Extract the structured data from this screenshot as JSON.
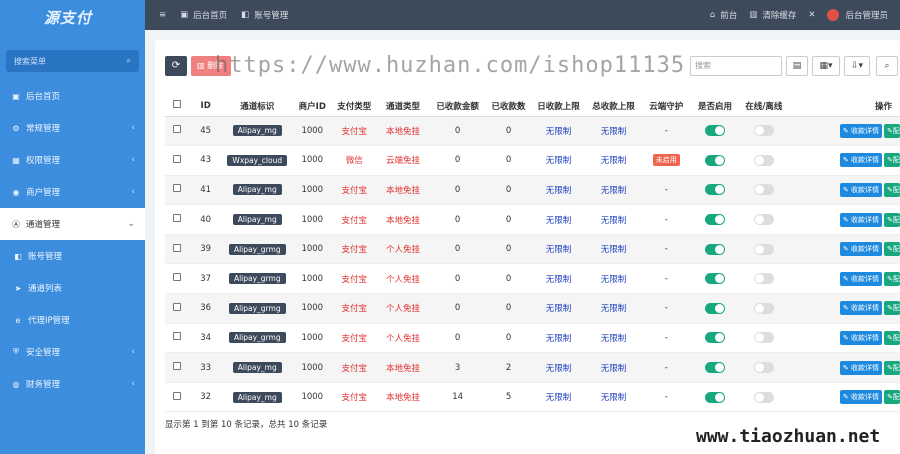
{
  "sidebar": {
    "logo_text": "源支付",
    "search_placeholder": "搜索菜单",
    "items": [
      {
        "label": "后台首页",
        "icon": "dashboard-icon",
        "glyph": "▣"
      },
      {
        "label": "常规管理",
        "icon": "gear-icon",
        "glyph": "⚙",
        "arrow": "‹"
      },
      {
        "label": "权限管理",
        "icon": "group-icon",
        "glyph": "▦",
        "arrow": "‹"
      },
      {
        "label": "商户管理",
        "icon": "user-icon",
        "glyph": "◉",
        "arrow": "‹"
      },
      {
        "label": "通道管理",
        "icon": "channel-icon",
        "glyph": "Ⓐ",
        "arrow": "⌄",
        "active": true
      }
    ],
    "sub_items": [
      {
        "label": "账号管理",
        "icon": "account-icon",
        "glyph": "◧"
      },
      {
        "label": "通道列表",
        "icon": "send-icon",
        "glyph": "➤"
      },
      {
        "label": "代理IP管理",
        "icon": "ie-icon",
        "glyph": "e"
      }
    ],
    "items_bottom": [
      {
        "label": "安全管理",
        "icon": "shield-icon",
        "glyph": "⛨",
        "arrow": "‹"
      },
      {
        "label": "财务管理",
        "icon": "money-icon",
        "glyph": "◍",
        "arrow": "‹"
      }
    ]
  },
  "topbar": {
    "menu_icon": "≡",
    "home_tab": "后台首页",
    "account_tab": "账号管理",
    "frontend": "前台",
    "clear_cache": "清除缓存",
    "admin": "后台管理员"
  },
  "toolbar": {
    "delete_label": "删除",
    "search_placeholder": "搜索"
  },
  "table": {
    "headers": [
      "ID",
      "通道标识",
      "商户ID",
      "支付类型",
      "通道类型",
      "已收款金额",
      "已收款数",
      "日收款上限",
      "总收款上限",
      "云端守护",
      "是否启用",
      "在线/离线",
      "操作"
    ],
    "rows": [
      {
        "id": "45",
        "tag": "Alipay_mg",
        "mid": "1000",
        "pay": "支付宝",
        "ctype": "本地免挂",
        "amount": "0",
        "count": "0",
        "daily": "无限制",
        "total": "无限制",
        "cloud": "-",
        "enabled": true,
        "online": false
      },
      {
        "id": "43",
        "tag": "Wxpay_cloud",
        "mid": "1000",
        "pay": "微信",
        "ctype": "云端免挂",
        "amount": "0",
        "count": "0",
        "daily": "无限制",
        "total": "无限制",
        "cloud": "未启用",
        "enabled": true,
        "online": false
      },
      {
        "id": "41",
        "tag": "Alipay_mg",
        "mid": "1000",
        "pay": "支付宝",
        "ctype": "本地免挂",
        "amount": "0",
        "count": "0",
        "daily": "无限制",
        "total": "无限制",
        "cloud": "-",
        "enabled": true,
        "online": false
      },
      {
        "id": "40",
        "tag": "Alipay_mg",
        "mid": "1000",
        "pay": "支付宝",
        "ctype": "本地免挂",
        "amount": "0",
        "count": "0",
        "daily": "无限制",
        "total": "无限制",
        "cloud": "-",
        "enabled": true,
        "online": false
      },
      {
        "id": "39",
        "tag": "Alipay_grmg",
        "mid": "1000",
        "pay": "支付宝",
        "ctype": "个人免挂",
        "amount": "0",
        "count": "0",
        "daily": "无限制",
        "total": "无限制",
        "cloud": "-",
        "enabled": true,
        "online": false
      },
      {
        "id": "37",
        "tag": "Alipay_grmg",
        "mid": "1000",
        "pay": "支付宝",
        "ctype": "个人免挂",
        "amount": "0",
        "count": "0",
        "daily": "无限制",
        "total": "无限制",
        "cloud": "-",
        "enabled": true,
        "online": false
      },
      {
        "id": "36",
        "tag": "Alipay_grmg",
        "mid": "1000",
        "pay": "支付宝",
        "ctype": "个人免挂",
        "amount": "0",
        "count": "0",
        "daily": "无限制",
        "total": "无限制",
        "cloud": "-",
        "enabled": true,
        "online": false
      },
      {
        "id": "34",
        "tag": "Alipay_grmg",
        "mid": "1000",
        "pay": "支付宝",
        "ctype": "个人免挂",
        "amount": "0",
        "count": "0",
        "daily": "无限制",
        "total": "无限制",
        "cloud": "-",
        "enabled": true,
        "online": false
      },
      {
        "id": "33",
        "tag": "Alipay_mg",
        "mid": "1000",
        "pay": "支付宝",
        "ctype": "本地免挂",
        "amount": "3",
        "count": "2",
        "daily": "无限制",
        "total": "无限制",
        "cloud": "-",
        "enabled": true,
        "online": false
      },
      {
        "id": "32",
        "tag": "Alipay_mg",
        "mid": "1000",
        "pay": "支付宝",
        "ctype": "本地免挂",
        "amount": "14",
        "count": "5",
        "daily": "无限制",
        "total": "无限制",
        "cloud": "-",
        "enabled": true,
        "online": false
      }
    ],
    "op_detail": "收款详情",
    "op_config": "配"
  },
  "footer": "显示第 1 到第 10 条记录，总共 10 条记录",
  "watermark_top": "https://www.huzhan.com/ishop11135",
  "watermark_bottom": "www.tiaozhuan.net",
  "colors": {
    "sidebar": "#3c8dde",
    "topbar": "#3d4a5c",
    "enabled": "#18a880",
    "pay_red": "#e03030",
    "limit_blue": "#1d3fc0"
  }
}
